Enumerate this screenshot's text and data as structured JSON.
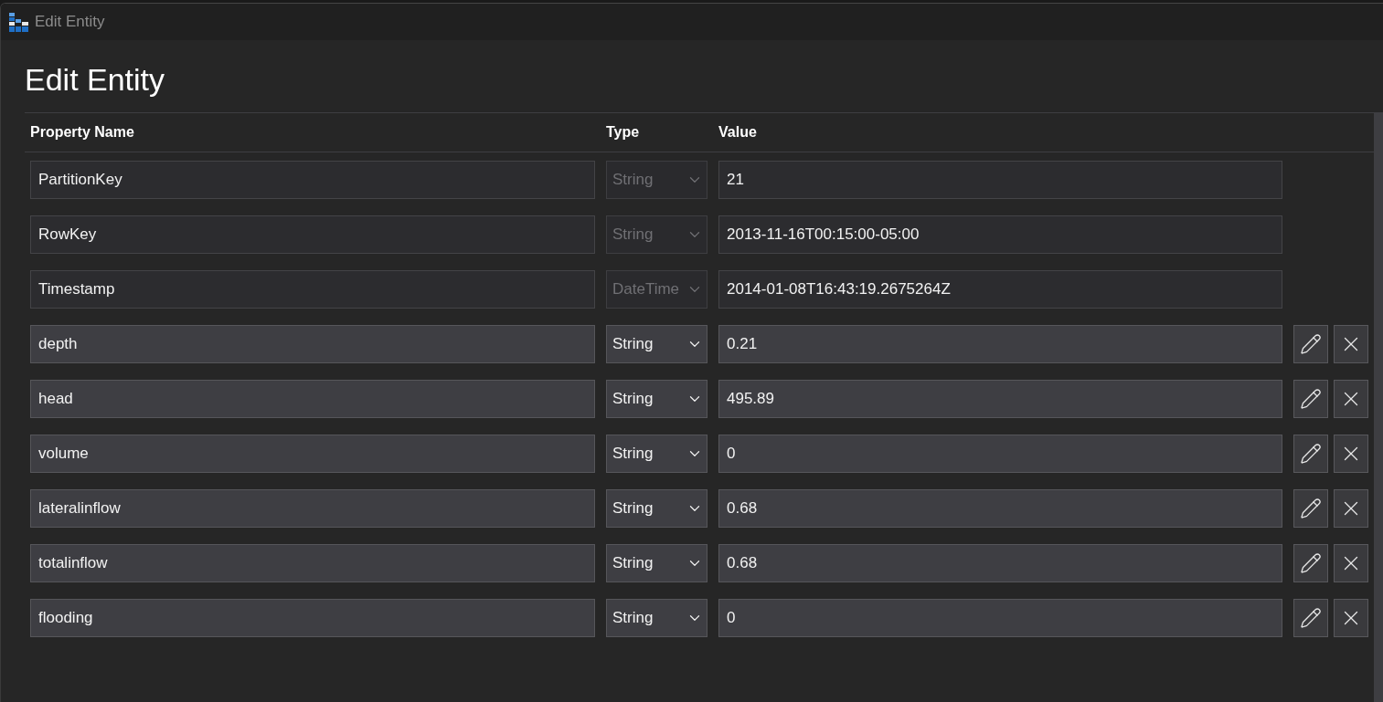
{
  "window": {
    "title": "Edit Entity"
  },
  "heading": "Edit Entity",
  "table": {
    "columns": [
      "Property Name",
      "Type",
      "Value"
    ],
    "rows": [
      {
        "name": "PartitionKey",
        "type": "String",
        "value": "21",
        "disabled": true
      },
      {
        "name": "RowKey",
        "type": "String",
        "value": "2013-11-16T00:15:00-05:00",
        "disabled": true
      },
      {
        "name": "Timestamp",
        "type": "DateTime",
        "value": "2014-01-08T16:43:19.2675264Z",
        "disabled": true
      },
      {
        "name": "depth",
        "type": "String",
        "value": "0.21",
        "disabled": false
      },
      {
        "name": "head",
        "type": "String",
        "value": "495.89",
        "disabled": false
      },
      {
        "name": "volume",
        "type": "String",
        "value": "0",
        "disabled": false
      },
      {
        "name": "lateralinflow",
        "type": "String",
        "value": "0.68",
        "disabled": false
      },
      {
        "name": "totalinflow",
        "type": "String",
        "value": "0.68",
        "disabled": false
      },
      {
        "name": "flooding",
        "type": "String",
        "value": "0",
        "disabled": false
      }
    ]
  }
}
